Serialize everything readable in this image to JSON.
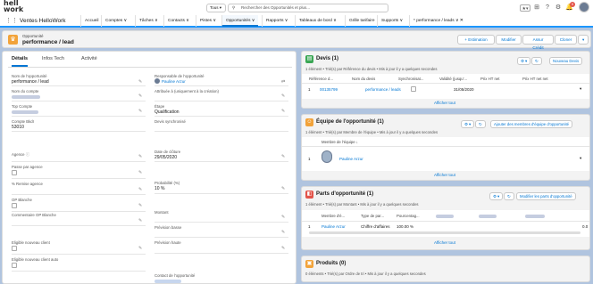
{
  "header": {
    "logo_line1": "hell",
    "logo_line2": "work",
    "search_scope": "Tous",
    "search_placeholder": "Rechercher des Opportunités et plus...",
    "notification_count": "9"
  },
  "nav": {
    "app_name": "Ventes HelloWork",
    "items": [
      {
        "label": "Accueil"
      },
      {
        "label": "Comptes"
      },
      {
        "label": "Tâches"
      },
      {
        "label": "Contacts"
      },
      {
        "label": "Pistes"
      },
      {
        "label": "Opportunités"
      },
      {
        "label": "Rapports"
      },
      {
        "label": "Tableaux de bord"
      },
      {
        "label": "Grille tarifaire"
      },
      {
        "label": "Supports"
      },
      {
        "label": "* performance / leads"
      }
    ]
  },
  "record": {
    "type": "Opportunité",
    "title": "performance / lead",
    "buttons": [
      "+ Estimation",
      "Modifier",
      "Assur Crédit",
      "Cloner"
    ]
  },
  "tabs": [
    "Détails",
    "Infos Tech",
    "Activité"
  ],
  "left_fields": {
    "nom_opportunite_label": "Nom de l'opportunité",
    "nom_opportunite_value": "performance / lead",
    "nom_compte_label": "Nom du compte",
    "top_compte_label": "Top Compte",
    "compte_bkdl_label": "Compte BkdI",
    "compte_bkdl_value": "53010",
    "agence_label": "Agence",
    "passe_agence_label": "Passe par agence",
    "remise_agence_label": "% Remise agence",
    "op_blanche_label": "OP Blanche",
    "commentaire_op_label": "Commentaire OP Blanche",
    "eligible_client_label": "Eligible nouveau client",
    "eligible_client_auto_label": "Eligible nouveau client auto",
    "responsable_label": "Responsable de l'opportunité",
    "responsable_value": "Pauline Arzur",
    "attribuee_label": "Attribuée à (uniquement à la création)",
    "etape_label": "Étape",
    "etape_value": "Qualification",
    "devis_sync_label": "Devis synchronisé",
    "date_cloture_label": "Date de clôture",
    "date_cloture_value": "29/05/2020",
    "probabilite_label": "Probabilité (%)",
    "probabilite_value": "10 %",
    "montant_label": "Montant",
    "prevision_basse_label": "Prévision basse",
    "prevision_haute_label": "Prévision haute",
    "contact_label": "Contact de l'opportunité"
  },
  "devis_card": {
    "title": "Devis (1)",
    "subtitle": "1 élément • Trié(s) par Référence du devis • Mis à jour il y a quelques secondes",
    "button": "Nouveau Devis",
    "columns": [
      "Référence d...",
      "Nom du devis",
      "Synchronisat...",
      "Validité (jusqu'...",
      "Prix HT net",
      "Prix HT net net"
    ],
    "rows": [
      {
        "num": "1",
        "ref": "00135799",
        "name": "performance / leads",
        "validity": "31/05/2020"
      }
    ],
    "show_all": "Afficher tout"
  },
  "equipe_card": {
    "title": "Équipe de l'opportunité (1)",
    "subtitle": "1 élément • Trié(s) par Membre de l'équipe • Mis à jour il y a quelques secondes",
    "button": "Ajouter des membres d'équipe d'opportunité",
    "column": "Membre de l'équipe ↓",
    "rows": [
      {
        "num": "1",
        "name": "Pauline Arzur"
      }
    ],
    "show_all": "Afficher tout"
  },
  "parts_card": {
    "title": "Parts d'opportunité (1)",
    "subtitle": "1 élément • Trié(s) par Montant • Mis à jour il y a quelques secondes",
    "button": "Modifier les parts d'opportunité",
    "columns": [
      "Membre d'é...",
      "Type de par...",
      "Pourcentag..."
    ],
    "rows": [
      {
        "num": "1",
        "member": "Pauline Arzur",
        "type": "Chiffre d'affaires",
        "pct": "100.00 %",
        "extra": "0.0"
      }
    ],
    "show_all": "Afficher tout"
  },
  "produits_card": {
    "title": "Produits (0)",
    "subtitle": "0 éléments • Trié(s) par Ordre de tri • Mis à jour il y a quelques secondes"
  },
  "colors": {
    "accent": "#0176d3",
    "devis": "#3ba755",
    "equipe": "#f2a33a",
    "parts": "#e3544a",
    "produits": "#f2a33a"
  }
}
